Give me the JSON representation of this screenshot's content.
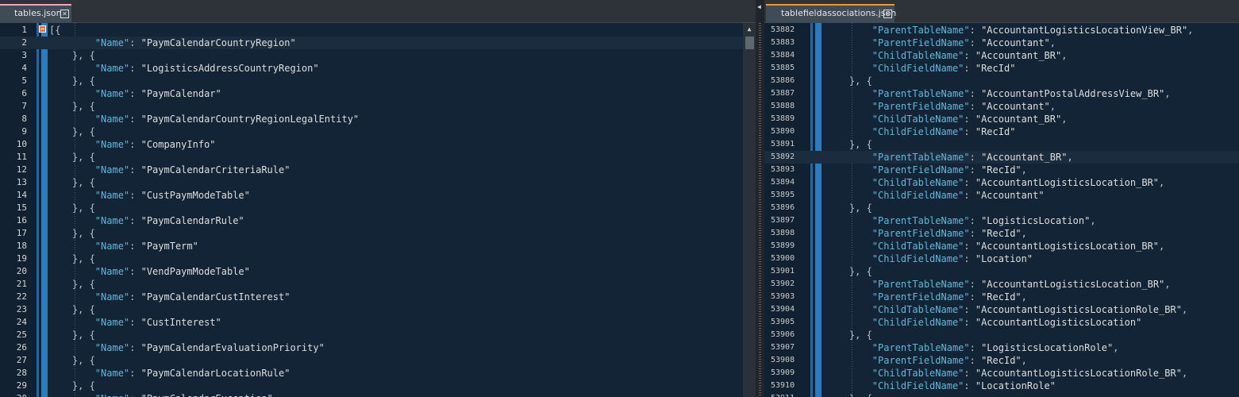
{
  "left_editor": {
    "tab_label": "tables.json",
    "lines": [
      {
        "n": "1",
        "parts": [
          [
            "punc",
            "[{"
          ]
        ]
      },
      {
        "n": "2",
        "parts": [
          [
            "key",
            "        \"Name\""
          ],
          [
            "punc",
            ": "
          ],
          [
            "str",
            "\"PaymCalendarCountryRegion\""
          ]
        ]
      },
      {
        "n": "3",
        "parts": [
          [
            "punc",
            "    }, {"
          ]
        ]
      },
      {
        "n": "4",
        "parts": [
          [
            "key",
            "        \"Name\""
          ],
          [
            "punc",
            ": "
          ],
          [
            "str",
            "\"LogisticsAddressCountryRegion\""
          ]
        ]
      },
      {
        "n": "5",
        "parts": [
          [
            "punc",
            "    }, {"
          ]
        ]
      },
      {
        "n": "6",
        "parts": [
          [
            "key",
            "        \"Name\""
          ],
          [
            "punc",
            ": "
          ],
          [
            "str",
            "\"PaymCalendar\""
          ]
        ]
      },
      {
        "n": "7",
        "parts": [
          [
            "punc",
            "    }, {"
          ]
        ]
      },
      {
        "n": "8",
        "parts": [
          [
            "key",
            "        \"Name\""
          ],
          [
            "punc",
            ": "
          ],
          [
            "str",
            "\"PaymCalendarCountryRegionLegalEntity\""
          ]
        ]
      },
      {
        "n": "9",
        "parts": [
          [
            "punc",
            "    }, {"
          ]
        ]
      },
      {
        "n": "10",
        "parts": [
          [
            "key",
            "        \"Name\""
          ],
          [
            "punc",
            ": "
          ],
          [
            "str",
            "\"CompanyInfo\""
          ]
        ]
      },
      {
        "n": "11",
        "parts": [
          [
            "punc",
            "    }, {"
          ]
        ]
      },
      {
        "n": "12",
        "parts": [
          [
            "key",
            "        \"Name\""
          ],
          [
            "punc",
            ": "
          ],
          [
            "str",
            "\"PaymCalendarCriteriaRule\""
          ]
        ]
      },
      {
        "n": "13",
        "parts": [
          [
            "punc",
            "    }, {"
          ]
        ]
      },
      {
        "n": "14",
        "parts": [
          [
            "key",
            "        \"Name\""
          ],
          [
            "punc",
            ": "
          ],
          [
            "str",
            "\"CustPaymModeTable\""
          ]
        ]
      },
      {
        "n": "15",
        "parts": [
          [
            "punc",
            "    }, {"
          ]
        ]
      },
      {
        "n": "16",
        "parts": [
          [
            "key",
            "        \"Name\""
          ],
          [
            "punc",
            ": "
          ],
          [
            "str",
            "\"PaymCalendarRule\""
          ]
        ]
      },
      {
        "n": "17",
        "parts": [
          [
            "punc",
            "    }, {"
          ]
        ]
      },
      {
        "n": "18",
        "parts": [
          [
            "key",
            "        \"Name\""
          ],
          [
            "punc",
            ": "
          ],
          [
            "str",
            "\"PaymTerm\""
          ]
        ]
      },
      {
        "n": "19",
        "parts": [
          [
            "punc",
            "    }, {"
          ]
        ]
      },
      {
        "n": "20",
        "parts": [
          [
            "key",
            "        \"Name\""
          ],
          [
            "punc",
            ": "
          ],
          [
            "str",
            "\"VendPaymModeTable\""
          ]
        ]
      },
      {
        "n": "21",
        "parts": [
          [
            "punc",
            "    }, {"
          ]
        ]
      },
      {
        "n": "22",
        "parts": [
          [
            "key",
            "        \"Name\""
          ],
          [
            "punc",
            ": "
          ],
          [
            "str",
            "\"PaymCalendarCustInterest\""
          ]
        ]
      },
      {
        "n": "23",
        "parts": [
          [
            "punc",
            "    }, {"
          ]
        ]
      },
      {
        "n": "24",
        "parts": [
          [
            "key",
            "        \"Name\""
          ],
          [
            "punc",
            ": "
          ],
          [
            "str",
            "\"CustInterest\""
          ]
        ]
      },
      {
        "n": "25",
        "parts": [
          [
            "punc",
            "    }, {"
          ]
        ]
      },
      {
        "n": "26",
        "parts": [
          [
            "key",
            "        \"Name\""
          ],
          [
            "punc",
            ": "
          ],
          [
            "str",
            "\"PaymCalendarEvaluationPriority\""
          ]
        ]
      },
      {
        "n": "27",
        "parts": [
          [
            "punc",
            "    }, {"
          ]
        ]
      },
      {
        "n": "28",
        "parts": [
          [
            "key",
            "        \"Name\""
          ],
          [
            "punc",
            ": "
          ],
          [
            "str",
            "\"PaymCalendarLocationRule\""
          ]
        ]
      },
      {
        "n": "29",
        "parts": [
          [
            "punc",
            "    }, {"
          ]
        ]
      },
      {
        "n": "30",
        "parts": [
          [
            "key",
            "        \"Name\""
          ],
          [
            "punc",
            ": "
          ],
          [
            "str",
            "\"PaymCalendarException\""
          ]
        ]
      }
    ]
  },
  "right_editor": {
    "tab_label": "tablefieldassociations.json",
    "lines": [
      {
        "n": "53882",
        "parts": [
          [
            "key",
            "        \"ParentTableName\""
          ],
          [
            "punc",
            ": "
          ],
          [
            "str",
            "\"AccountantLogisticsLocationView_BR\""
          ],
          [
            "punc",
            ","
          ]
        ]
      },
      {
        "n": "53883",
        "parts": [
          [
            "key",
            "        \"ParentFieldName\""
          ],
          [
            "punc",
            ": "
          ],
          [
            "str",
            "\"Accountant\""
          ],
          [
            "punc",
            ","
          ]
        ]
      },
      {
        "n": "53884",
        "parts": [
          [
            "key",
            "        \"ChildTableName\""
          ],
          [
            "punc",
            ": "
          ],
          [
            "str",
            "\"Accountant_BR\""
          ],
          [
            "punc",
            ","
          ]
        ]
      },
      {
        "n": "53885",
        "parts": [
          [
            "key",
            "        \"ChildFieldName\""
          ],
          [
            "punc",
            ": "
          ],
          [
            "str",
            "\"RecId\""
          ]
        ]
      },
      {
        "n": "53886",
        "parts": [
          [
            "punc",
            "    }, {"
          ]
        ]
      },
      {
        "n": "53887",
        "parts": [
          [
            "key",
            "        \"ParentTableName\""
          ],
          [
            "punc",
            ": "
          ],
          [
            "str",
            "\"AccountantPostalAddressView_BR\""
          ],
          [
            "punc",
            ","
          ]
        ]
      },
      {
        "n": "53888",
        "parts": [
          [
            "key",
            "        \"ParentFieldName\""
          ],
          [
            "punc",
            ": "
          ],
          [
            "str",
            "\"Accountant\""
          ],
          [
            "punc",
            ","
          ]
        ]
      },
      {
        "n": "53889",
        "parts": [
          [
            "key",
            "        \"ChildTableName\""
          ],
          [
            "punc",
            ": "
          ],
          [
            "str",
            "\"Accountant_BR\""
          ],
          [
            "punc",
            ","
          ]
        ]
      },
      {
        "n": "53890",
        "parts": [
          [
            "key",
            "        \"ChildFieldName\""
          ],
          [
            "punc",
            ": "
          ],
          [
            "str",
            "\"RecId\""
          ]
        ]
      },
      {
        "n": "53891",
        "parts": [
          [
            "punc",
            "    }, {"
          ]
        ]
      },
      {
        "n": "53892",
        "parts": [
          [
            "key",
            "        \"ParentTableName\""
          ],
          [
            "punc",
            ": "
          ],
          [
            "str",
            "\"Accountant_BR\""
          ],
          [
            "punc",
            ","
          ]
        ]
      },
      {
        "n": "53893",
        "parts": [
          [
            "key",
            "        \"ParentFieldName\""
          ],
          [
            "punc",
            ": "
          ],
          [
            "str",
            "\"RecId\""
          ],
          [
            "punc",
            ","
          ]
        ]
      },
      {
        "n": "53894",
        "parts": [
          [
            "key",
            "        \"ChildTableName\""
          ],
          [
            "punc",
            ": "
          ],
          [
            "str",
            "\"AccountantLogisticsLocation_BR\""
          ],
          [
            "punc",
            ","
          ]
        ]
      },
      {
        "n": "53895",
        "parts": [
          [
            "key",
            "        \"ChildFieldName\""
          ],
          [
            "punc",
            ": "
          ],
          [
            "str",
            "\"Accountant\""
          ]
        ]
      },
      {
        "n": "53896",
        "parts": [
          [
            "punc",
            "    }, {"
          ]
        ]
      },
      {
        "n": "53897",
        "parts": [
          [
            "key",
            "        \"ParentTableName\""
          ],
          [
            "punc",
            ": "
          ],
          [
            "str",
            "\"LogisticsLocation\""
          ],
          [
            "punc",
            ","
          ]
        ]
      },
      {
        "n": "53898",
        "parts": [
          [
            "key",
            "        \"ParentFieldName\""
          ],
          [
            "punc",
            ": "
          ],
          [
            "str",
            "\"RecId\""
          ],
          [
            "punc",
            ","
          ]
        ]
      },
      {
        "n": "53899",
        "parts": [
          [
            "key",
            "        \"ChildTableName\""
          ],
          [
            "punc",
            ": "
          ],
          [
            "str",
            "\"AccountantLogisticsLocation_BR\""
          ],
          [
            "punc",
            ","
          ]
        ]
      },
      {
        "n": "53900",
        "parts": [
          [
            "key",
            "        \"ChildFieldName\""
          ],
          [
            "punc",
            ": "
          ],
          [
            "str",
            "\"Location\""
          ]
        ]
      },
      {
        "n": "53901",
        "parts": [
          [
            "punc",
            "    }, {"
          ]
        ]
      },
      {
        "n": "53902",
        "parts": [
          [
            "key",
            "        \"ParentTableName\""
          ],
          [
            "punc",
            ": "
          ],
          [
            "str",
            "\"AccountantLogisticsLocation_BR\""
          ],
          [
            "punc",
            ","
          ]
        ]
      },
      {
        "n": "53903",
        "parts": [
          [
            "key",
            "        \"ParentFieldName\""
          ],
          [
            "punc",
            ": "
          ],
          [
            "str",
            "\"RecId\""
          ],
          [
            "punc",
            ","
          ]
        ]
      },
      {
        "n": "53904",
        "parts": [
          [
            "key",
            "        \"ChildTableName\""
          ],
          [
            "punc",
            ": "
          ],
          [
            "str",
            "\"AccountantLogisticsLocationRole_BR\""
          ],
          [
            "punc",
            ","
          ]
        ]
      },
      {
        "n": "53905",
        "parts": [
          [
            "key",
            "        \"ChildFieldName\""
          ],
          [
            "punc",
            ": "
          ],
          [
            "str",
            "\"AccountantLogisticsLocation\""
          ]
        ]
      },
      {
        "n": "53906",
        "parts": [
          [
            "punc",
            "    }, {"
          ]
        ]
      },
      {
        "n": "53907",
        "parts": [
          [
            "key",
            "        \"ParentTableName\""
          ],
          [
            "punc",
            ": "
          ],
          [
            "str",
            "\"LogisticsLocationRole\""
          ],
          [
            "punc",
            ","
          ]
        ]
      },
      {
        "n": "53908",
        "parts": [
          [
            "key",
            "        \"ParentFieldName\""
          ],
          [
            "punc",
            ": "
          ],
          [
            "str",
            "\"RecId\""
          ],
          [
            "punc",
            ","
          ]
        ]
      },
      {
        "n": "53909",
        "parts": [
          [
            "key",
            "        \"ChildTableName\""
          ],
          [
            "punc",
            ": "
          ],
          [
            "str",
            "\"AccountantLogisticsLocationRole_BR\""
          ],
          [
            "punc",
            ","
          ]
        ]
      },
      {
        "n": "53910",
        "parts": [
          [
            "key",
            "        \"ChildFieldName\""
          ],
          [
            "punc",
            ": "
          ],
          [
            "str",
            "\"LocationRole\""
          ]
        ]
      },
      {
        "n": "53911",
        "parts": [
          [
            "punc",
            "    }, {"
          ]
        ]
      }
    ]
  },
  "icons": {
    "tab_close": "close-icon",
    "fold": "fold-collapse-icon",
    "scroll_up": "scroll-up-arrow-icon",
    "splitter_arrow": "splitter-left-arrow-icon"
  },
  "colors": {
    "editor_bg": "#132437",
    "key": "#62b8d8",
    "string": "#dedede",
    "left_tab_accent": "#f3a4b4",
    "right_tab_accent": "#f0962f",
    "fold_bar": "#2a7cbf"
  }
}
